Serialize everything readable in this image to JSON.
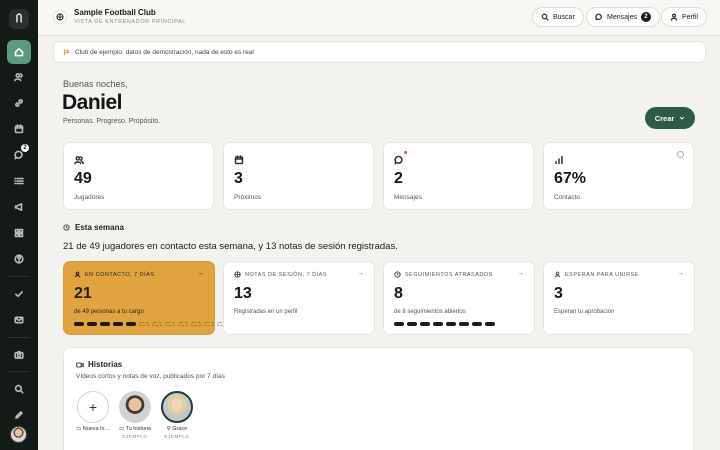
{
  "sidebar": {
    "logo": "Ⴖ",
    "messages_badge": "2",
    "items": [
      "home",
      "players",
      "links",
      "calendar",
      "messages",
      "list",
      "announcements",
      "grid",
      "help",
      "check",
      "mail",
      "camera",
      "search",
      "edit"
    ]
  },
  "topbar": {
    "club_name": "Sample Football Club",
    "club_sub": "VISTA DE ENTRENADOR PRINCIPAL",
    "search_label": "Buscar",
    "messages_label": "Mensajes",
    "messages_count": "2",
    "profile_label": "Perfil"
  },
  "notice": {
    "text": "Club de ejemplo: datos de demostración, nada de esto es real"
  },
  "greeting": {
    "salutation": "Buenas noches,",
    "name": "Daniel",
    "tagline": "Personas. Progreso. Propósito.",
    "create_label": "Crear"
  },
  "stats": [
    {
      "value": "49",
      "label": "Jugadores",
      "icon": "users-icon"
    },
    {
      "value": "3",
      "label": "Próximos",
      "icon": "calendar-icon"
    },
    {
      "value": "2",
      "label": "Mensajes",
      "icon": "chat-icon"
    },
    {
      "value": "67%",
      "label": "Contacto",
      "icon": "bar-chart-icon"
    }
  ],
  "week": {
    "title": "Esta semana",
    "summary": "21 de 49 jugadores en contacto esta semana, y 13 notas de sesión registradas.",
    "cards": [
      {
        "header": "EN CONTACTO, 7 DÍAS",
        "value": "21",
        "sub": "de 49 personas a tu cargo",
        "progress_segments": 12,
        "progress_filled": 5
      },
      {
        "header": "NOTAS DE SESIÓN, 7 DÍAS",
        "value": "13",
        "sub": "Registradas en un perfil"
      },
      {
        "header": "SEGUIMIENTOS ATRASADOS",
        "value": "8",
        "sub": "de 8 seguimientos abiertos",
        "progress_segments": 8,
        "progress_filled": 8
      },
      {
        "header": "ESPERAN PARA UNIRSE",
        "value": "3",
        "sub": "Esperan tu aprobación"
      }
    ]
  },
  "stories": {
    "title": "Historias",
    "subtitle": "Vídeos cortos y notas de voz, publicados por 7 días",
    "items": [
      {
        "name": "▭ Nueva hi…",
        "tag": ""
      },
      {
        "name": "▭ Tu historia",
        "tag": "EJEMPLO"
      },
      {
        "name": "⚲ Grace",
        "tag": "EJEMPLO"
      }
    ]
  },
  "colors": {
    "accent_green": "#2e5a48",
    "active_nav": "#5a9a7e",
    "highlight_card": "#e0a33f",
    "sidebar_bg": "#141a16"
  }
}
